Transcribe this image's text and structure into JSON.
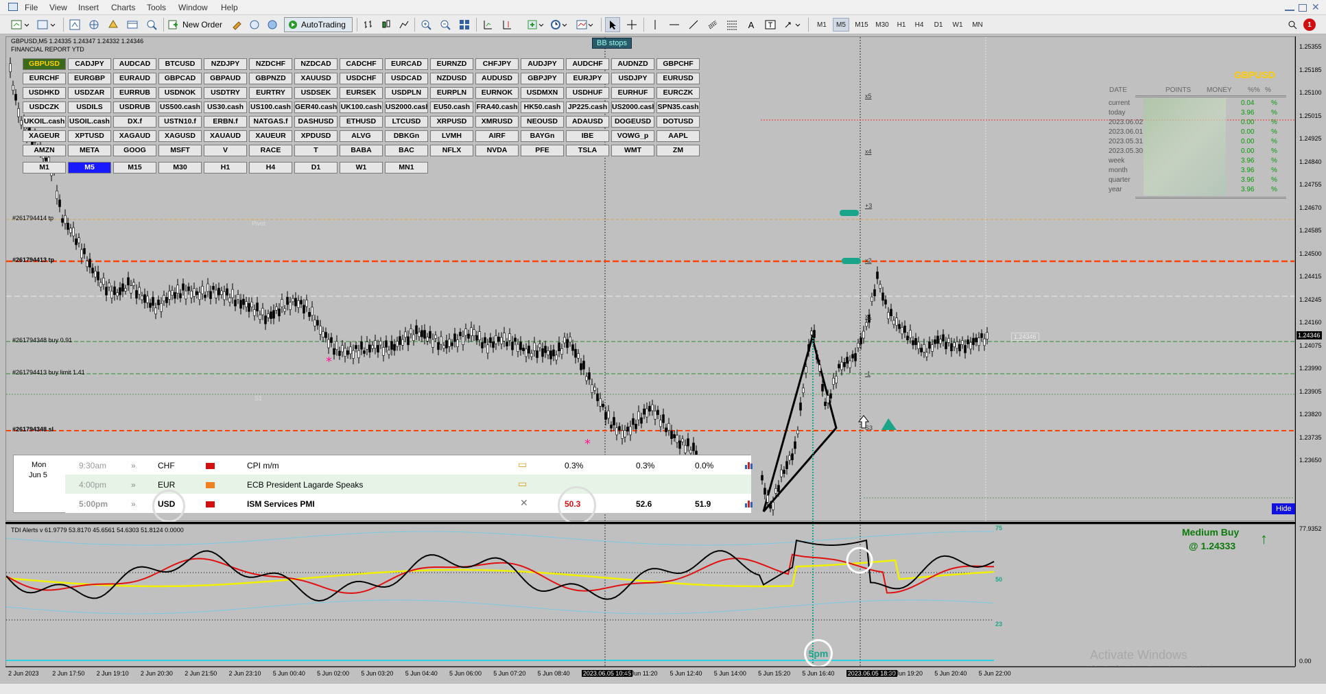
{
  "menu": [
    "File",
    "View",
    "Insert",
    "Charts",
    "Tools",
    "Window",
    "Help"
  ],
  "toolbar": {
    "new_order": "New Order",
    "autotrading": "AutoTrading",
    "timeframes": [
      "M1",
      "M5",
      "M15",
      "M30",
      "H1",
      "H4",
      "D1",
      "W1",
      "MN"
    ],
    "notification_count": "1"
  },
  "chart": {
    "header": "GBPUSD,M5  1.24335 1.24347 1.24332 1.24346",
    "subheader": "FINANCIAL REPORT YTD",
    "bb_stops": "BB stops",
    "pivot": "Pivot",
    "s1": "S1",
    "s3": "S3",
    "x_labels": [
      "x5",
      "x4",
      "+3",
      "x2",
      "x1",
      "-1"
    ],
    "current_price_label": "1.24346",
    "ghost_label": "1.24346",
    "order_lines": [
      {
        "text": "#261794414 tp"
      },
      {
        "text": "#261794413 tp"
      },
      {
        "text": "#261794348 buy 0.91"
      },
      {
        "text": "#261794413 buy limit 1.41"
      },
      {
        "text": "#261794348 sl"
      }
    ],
    "hide_label": "Hide",
    "colors": {
      "background": "#c0c0c0",
      "candle": "#000000",
      "tp_line": "#ff4400",
      "buy_line": "#2e8b2e",
      "signal_teal": "#1aa58a"
    }
  },
  "symbols": [
    [
      "GBPUSD",
      "CADJPY",
      "AUDCAD",
      "BTCUSD",
      "NZDJPY",
      "NZDCHF",
      "NZDCAD",
      "CADCHF",
      "EURCAD",
      "EURNZD",
      "CHFJPY",
      "AUDJPY",
      "AUDCHF",
      "AUDNZD",
      "GBPCHF"
    ],
    [
      "EURCHF",
      "EURGBP",
      "EURAUD",
      "GBPCAD",
      "GBPAUD",
      "GBPNZD",
      "XAUUSD",
      "USDCHF",
      "USDCAD",
      "NZDUSD",
      "AUDUSD",
      "GBPJPY",
      "EURJPY",
      "USDJPY",
      "EURUSD"
    ],
    [
      "USDHKD",
      "USDZAR",
      "EURRUB",
      "USDNOK",
      "USDTRY",
      "EURTRY",
      "USDSEK",
      "EURSEK",
      "USDPLN",
      "EURPLN",
      "EURNOK",
      "USDMXN",
      "USDHUF",
      "EURHUF",
      "EURCZK"
    ],
    [
      "USDCZK",
      "USDILS",
      "USDRUB",
      "US500.cash",
      "US30.cash",
      "US100.cash",
      "GER40.cash",
      "UK100.cash",
      "US2000.cash",
      "EU50.cash",
      "FRA40.cash",
      "HK50.cash",
      "JP225.cash",
      "US2000.cash",
      "SPN35.cash"
    ],
    [
      "UKOIL.cash",
      "USOIL.cash",
      "DX.f",
      "USTN10.f",
      "ERBN.f",
      "NATGAS.f",
      "DASHUSD",
      "ETHUSD",
      "LTCUSD",
      "XRPUSD",
      "XMRUSD",
      "NEOUSD",
      "ADAUSD",
      "DOGEUSD",
      "DOTUSD"
    ],
    [
      "XAGEUR",
      "XPTUSD",
      "XAGAUD",
      "XAGUSD",
      "XAUAUD",
      "XAUEUR",
      "XPDUSD",
      "ALVG",
      "DBKGn",
      "LVMH",
      "AIRF",
      "BAYGn",
      "IBE",
      "VOWG_p",
      "AAPL"
    ],
    [
      "AMZN",
      "META",
      "GOOG",
      "MSFT",
      "V",
      "RACE",
      "T",
      "BABA",
      "BAC",
      "NFLX",
      "NVDA",
      "PFE",
      "TSLA",
      "WMT",
      "ZM"
    ]
  ],
  "tf_buttons": [
    "M1",
    "M5",
    "M15",
    "M30",
    "H1",
    "H4",
    "D1",
    "W1",
    "MN1"
  ],
  "stats": {
    "symbol": "GBPUSD",
    "headers": [
      "DATE",
      "POINTS",
      "MONEY",
      "%%",
      "%"
    ],
    "rows": [
      {
        "label": "current",
        "pct": "0.04",
        "unit": "%"
      },
      {
        "label": "today",
        "pct": "3.96",
        "unit": "%"
      },
      {
        "label": "2023.06.02",
        "pct": "0.00",
        "unit": "%"
      },
      {
        "label": "2023.06.01",
        "pct": "0.00",
        "unit": "%"
      },
      {
        "label": "2023.05.31",
        "pct": "0.00",
        "unit": "%"
      },
      {
        "label": "2023.05.30",
        "pct": "0.00",
        "unit": "%"
      },
      {
        "label": "week",
        "pct": "3.96",
        "unit": "%"
      },
      {
        "label": "month",
        "pct": "3.96",
        "unit": "%"
      },
      {
        "label": "quarter",
        "pct": "3.96",
        "unit": "%"
      },
      {
        "label": "year",
        "pct": "3.96",
        "unit": "%"
      }
    ]
  },
  "calendar": {
    "day": "Mon",
    "date": "Jun 5",
    "events": [
      {
        "time": "9:30am",
        "currency": "CHF",
        "impact_color": "#d01010",
        "title": "CPI m/m",
        "actual": "0.3%",
        "forecast": "0.3%",
        "previous": "0.0%"
      },
      {
        "time": "4:00pm",
        "currency": "EUR",
        "impact_color": "#f08020",
        "title": "ECB President Lagarde Speaks",
        "actual": "",
        "forecast": "",
        "previous": ""
      },
      {
        "time": "5:00pm",
        "currency": "USD",
        "impact_color": "#d01010",
        "title": "ISM Services PMI",
        "actual": "50.3",
        "forecast": "52.6",
        "previous": "51.9"
      }
    ]
  },
  "indicator": {
    "header": "TDI Alerts v 61.9779 53.8170 45.6561 54.6303 51.8124 0.0000",
    "levels": [
      "75",
      "50",
      "23"
    ],
    "signal": "Medium Buy",
    "signal_price": "@ 1.24333",
    "marker_5pm": "5pm",
    "scale_top": "77.9352",
    "scale_bottom": "0.00"
  },
  "price_scale": [
    "1.25355",
    "1.25185",
    "1.25100",
    "1.25015",
    "1.24925",
    "1.24840",
    "1.24755",
    "1.24670",
    "1.24585",
    "1.24500",
    "1.24415",
    "1.24346",
    "1.24245",
    "1.24160",
    "1.24075",
    "1.23990",
    "1.23905",
    "1.23820",
    "1.23735",
    "1.23650"
  ],
  "time_labels": [
    "2 Jun 2023",
    "2 Jun 17:50",
    "2 Jun 19:10",
    "2 Jun 20:30",
    "2 Jun 21:50",
    "2 Jun 23:10",
    "5 Jun 00:40",
    "5 Jun 02:00",
    "5 Jun 03:20",
    "5 Jun 04:40",
    "5 Jun 06:00",
    "5 Jun 07:20",
    "5 Jun 08:40",
    "2023.06.05 10:45",
    "5 Jun 11:20",
    "5 Jun 12:40",
    "5 Jun 14:00",
    "5 Jun 15:20",
    "5 Jun 16:40",
    "2023.06.05 18:30",
    "5 Jun 19:20",
    "5 Jun 20:40",
    "5 Jun 22:00"
  ],
  "watermark": {
    "title": "Activate Windows",
    "subtitle": "Go to Settings to activate Windows."
  }
}
